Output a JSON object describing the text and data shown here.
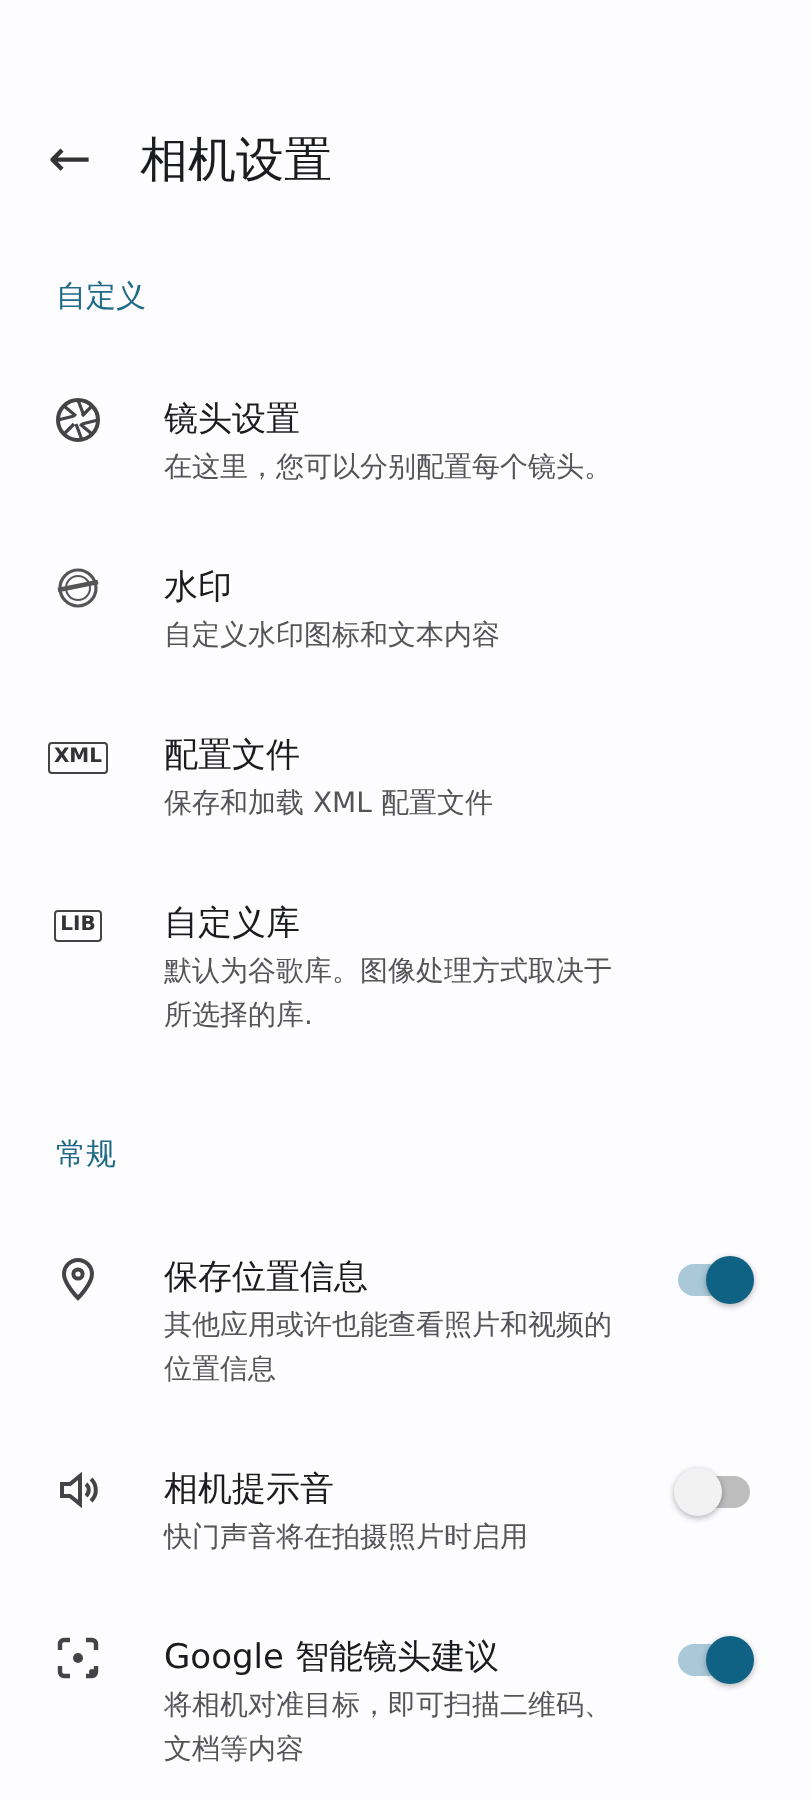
{
  "app_bar": {
    "back": "←",
    "title": "相机设置"
  },
  "sections": [
    {
      "title": "自定义",
      "items": [
        {
          "kind": "link",
          "title": "镜头设置",
          "subtitle": "在这里，您可以分别配置每个镜头。"
        },
        {
          "kind": "link",
          "title": "水印",
          "subtitle": "自定义水印图标和文本内容"
        },
        {
          "kind": "link",
          "badge": "XML",
          "title": "配置文件",
          "subtitle": "保存和加载 XML 配置文件"
        },
        {
          "kind": "link",
          "badge": "LIB",
          "title": "自定义库",
          "subtitle": "默认为谷歌库。图像处理方式取决于所选择的库."
        }
      ]
    },
    {
      "title": "常规",
      "items": [
        {
          "kind": "toggle",
          "title": "保存位置信息",
          "subtitle": "其他应用或许也能查看照片和视频的位置信息",
          "on": true
        },
        {
          "kind": "toggle",
          "title": "相机提示音",
          "subtitle": "快门声音将在拍摄照片时启用",
          "on": false
        },
        {
          "kind": "toggle",
          "title": "Google 智能镜头建议",
          "subtitle": "将相机对准目标，即可扫描二维码、文档等内容",
          "on": true
        }
      ]
    }
  ]
}
